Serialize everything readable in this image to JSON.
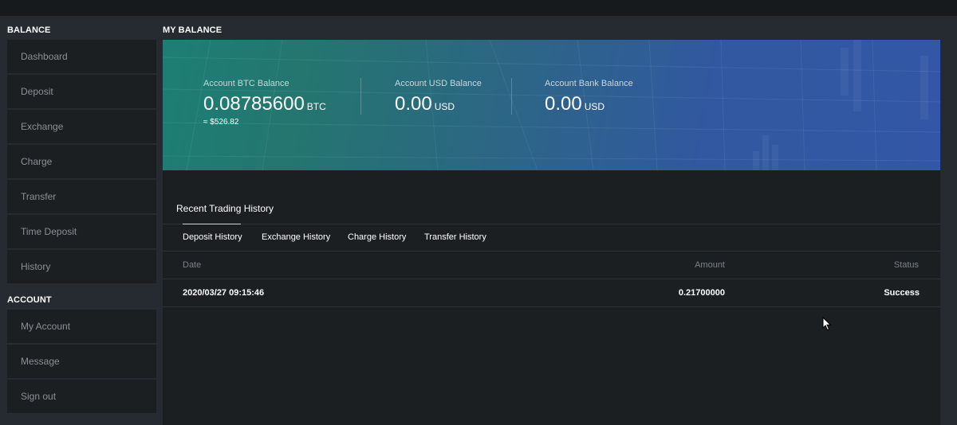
{
  "sidebar": {
    "balance_title": "BALANCE",
    "balance_items": [
      {
        "label": "Dashboard"
      },
      {
        "label": "Deposit"
      },
      {
        "label": "Exchange"
      },
      {
        "label": "Charge"
      },
      {
        "label": "Transfer"
      },
      {
        "label": "Time Deposit"
      },
      {
        "label": "History"
      }
    ],
    "account_title": "ACCOUNT",
    "account_items": [
      {
        "label": "My Account"
      },
      {
        "label": "Message"
      },
      {
        "label": "Sign out"
      }
    ]
  },
  "main": {
    "title": "MY BALANCE",
    "balances": {
      "btc": {
        "label": "Account BTC Balance",
        "value": "0.08785600",
        "unit": "BTC",
        "approx": "≈ $526.82"
      },
      "usd": {
        "label": "Account USD Balance",
        "value": "0.00",
        "unit": "USD"
      },
      "bank": {
        "label": "Account Bank Balance",
        "value": "0.00",
        "unit": "USD"
      }
    },
    "history": {
      "title": "Recent Trading History",
      "tabs": [
        {
          "label": "Deposit History"
        },
        {
          "label": "Exchange History"
        },
        {
          "label": "Charge History"
        },
        {
          "label": "Transfer History"
        }
      ],
      "columns": {
        "date": "Date",
        "amount": "Amount",
        "status": "Status"
      },
      "rows": [
        {
          "date": "2020/03/27 09:15:46",
          "amount": "0.21700000",
          "status": "Success"
        }
      ]
    }
  },
  "colors": {
    "background": "#1b1f22",
    "panel": "#252b30",
    "banner_start": "#1d7f74",
    "banner_end": "#3357a6"
  }
}
